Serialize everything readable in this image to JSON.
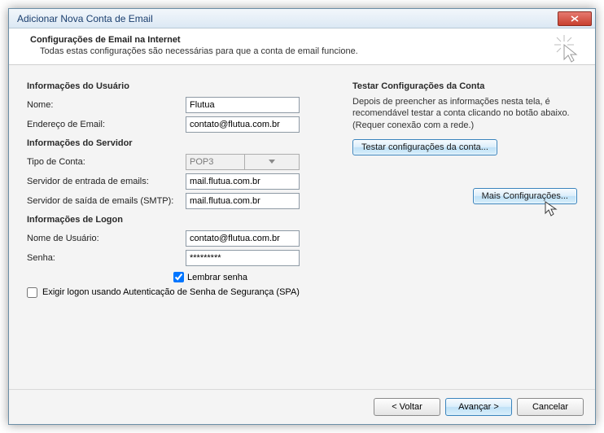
{
  "window": {
    "title": "Adicionar Nova Conta de Email"
  },
  "header": {
    "title": "Configurações de Email na Internet",
    "subtitle": "Todas estas configurações são necessárias para que a conta de email funcione."
  },
  "sections": {
    "user_info": "Informações do Usuário",
    "server_info": "Informações do Servidor",
    "logon_info": "Informações de Logon",
    "test_title": "Testar Configurações da Conta"
  },
  "labels": {
    "name": "Nome:",
    "email": "Endereço de Email:",
    "acct_type": "Tipo de Conta:",
    "incoming": "Servidor de entrada de emails:",
    "outgoing": "Servidor de saída de emails (SMTP):",
    "username": "Nome de Usuário:",
    "password": "Senha:",
    "remember": "Lembrar senha",
    "spa": "Exigir logon usando Autenticação de Senha de Segurança (SPA)"
  },
  "values": {
    "name": "Flutua",
    "email": "contato@flutua.com.br",
    "acct_type": "POP3",
    "incoming": "mail.flutua.com.br",
    "outgoing": "mail.flutua.com.br",
    "username": "contato@flutua.com.br",
    "password": "*********",
    "remember_checked": true,
    "spa_checked": false
  },
  "right": {
    "desc": "Depois de preencher as informações nesta tela, é recomendável testar a conta clicando no botão abaixo. (Requer conexão com a rede.)",
    "test_btn": "Testar configurações da conta...",
    "more_btn": "Mais Configurações..."
  },
  "footer": {
    "back": "< Voltar",
    "next": "Avançar >",
    "cancel": "Cancelar"
  }
}
